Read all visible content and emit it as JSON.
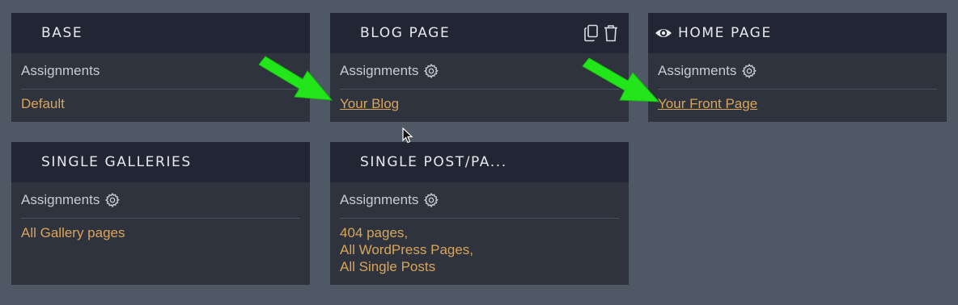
{
  "assignments_label": "Assignments",
  "cards": {
    "base": {
      "title": "BASE",
      "values": [
        "Default"
      ]
    },
    "blog": {
      "title": "BLOG PAGE",
      "values": [
        "Your Blog"
      ]
    },
    "home": {
      "title": "HOME PAGE",
      "values": [
        "Your Front Page"
      ]
    },
    "galleries": {
      "title": "SINGLE GALLERIES",
      "values": [
        "All Gallery pages"
      ]
    },
    "single_post": {
      "title": "SINGLE POST/PA...",
      "values": [
        "404 pages,",
        "All WordPress Pages,",
        "All Single Posts"
      ]
    }
  },
  "icons": {
    "gear": "gear-icon",
    "copy": "copy-icon",
    "trash": "trash-icon",
    "eye": "eye-icon",
    "arrow": "green-arrow-annotation",
    "cursor": "mouse-cursor-icon"
  },
  "colors": {
    "background": "#4f5966",
    "card_body": "#2e333d",
    "card_header": "#222634",
    "value_link": "#d9a55a",
    "arrow": "#22e61a"
  }
}
